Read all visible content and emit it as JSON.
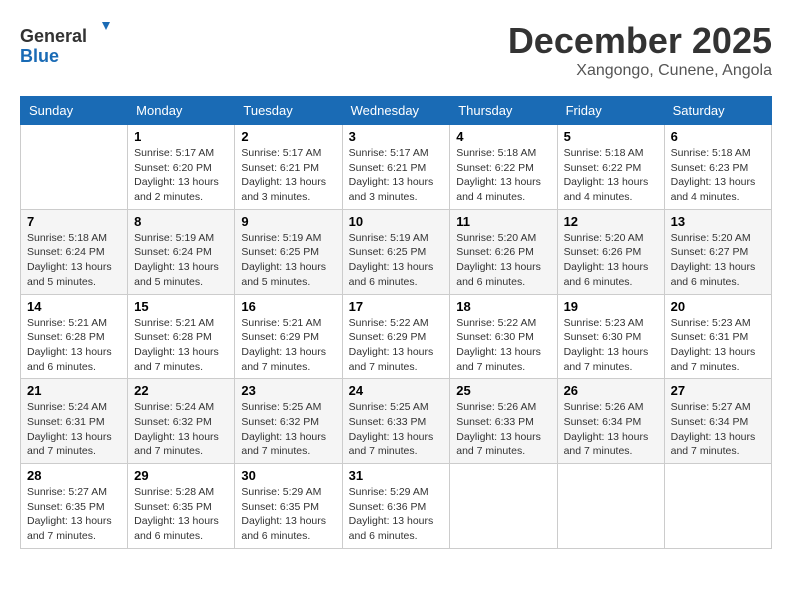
{
  "header": {
    "logo_line1": "General",
    "logo_line2": "Blue",
    "month": "December 2025",
    "location": "Xangongo, Cunene, Angola"
  },
  "weekdays": [
    "Sunday",
    "Monday",
    "Tuesday",
    "Wednesday",
    "Thursday",
    "Friday",
    "Saturday"
  ],
  "weeks": [
    [
      {
        "day": "",
        "info": ""
      },
      {
        "day": "1",
        "info": "Sunrise: 5:17 AM\nSunset: 6:20 PM\nDaylight: 13 hours\nand 2 minutes."
      },
      {
        "day": "2",
        "info": "Sunrise: 5:17 AM\nSunset: 6:21 PM\nDaylight: 13 hours\nand 3 minutes."
      },
      {
        "day": "3",
        "info": "Sunrise: 5:17 AM\nSunset: 6:21 PM\nDaylight: 13 hours\nand 3 minutes."
      },
      {
        "day": "4",
        "info": "Sunrise: 5:18 AM\nSunset: 6:22 PM\nDaylight: 13 hours\nand 4 minutes."
      },
      {
        "day": "5",
        "info": "Sunrise: 5:18 AM\nSunset: 6:22 PM\nDaylight: 13 hours\nand 4 minutes."
      },
      {
        "day": "6",
        "info": "Sunrise: 5:18 AM\nSunset: 6:23 PM\nDaylight: 13 hours\nand 4 minutes."
      }
    ],
    [
      {
        "day": "7",
        "info": "Sunrise: 5:18 AM\nSunset: 6:24 PM\nDaylight: 13 hours\nand 5 minutes."
      },
      {
        "day": "8",
        "info": "Sunrise: 5:19 AM\nSunset: 6:24 PM\nDaylight: 13 hours\nand 5 minutes."
      },
      {
        "day": "9",
        "info": "Sunrise: 5:19 AM\nSunset: 6:25 PM\nDaylight: 13 hours\nand 5 minutes."
      },
      {
        "day": "10",
        "info": "Sunrise: 5:19 AM\nSunset: 6:25 PM\nDaylight: 13 hours\nand 6 minutes."
      },
      {
        "day": "11",
        "info": "Sunrise: 5:20 AM\nSunset: 6:26 PM\nDaylight: 13 hours\nand 6 minutes."
      },
      {
        "day": "12",
        "info": "Sunrise: 5:20 AM\nSunset: 6:26 PM\nDaylight: 13 hours\nand 6 minutes."
      },
      {
        "day": "13",
        "info": "Sunrise: 5:20 AM\nSunset: 6:27 PM\nDaylight: 13 hours\nand 6 minutes."
      }
    ],
    [
      {
        "day": "14",
        "info": "Sunrise: 5:21 AM\nSunset: 6:28 PM\nDaylight: 13 hours\nand 6 minutes."
      },
      {
        "day": "15",
        "info": "Sunrise: 5:21 AM\nSunset: 6:28 PM\nDaylight: 13 hours\nand 7 minutes."
      },
      {
        "day": "16",
        "info": "Sunrise: 5:21 AM\nSunset: 6:29 PM\nDaylight: 13 hours\nand 7 minutes."
      },
      {
        "day": "17",
        "info": "Sunrise: 5:22 AM\nSunset: 6:29 PM\nDaylight: 13 hours\nand 7 minutes."
      },
      {
        "day": "18",
        "info": "Sunrise: 5:22 AM\nSunset: 6:30 PM\nDaylight: 13 hours\nand 7 minutes."
      },
      {
        "day": "19",
        "info": "Sunrise: 5:23 AM\nSunset: 6:30 PM\nDaylight: 13 hours\nand 7 minutes."
      },
      {
        "day": "20",
        "info": "Sunrise: 5:23 AM\nSunset: 6:31 PM\nDaylight: 13 hours\nand 7 minutes."
      }
    ],
    [
      {
        "day": "21",
        "info": "Sunrise: 5:24 AM\nSunset: 6:31 PM\nDaylight: 13 hours\nand 7 minutes."
      },
      {
        "day": "22",
        "info": "Sunrise: 5:24 AM\nSunset: 6:32 PM\nDaylight: 13 hours\nand 7 minutes."
      },
      {
        "day": "23",
        "info": "Sunrise: 5:25 AM\nSunset: 6:32 PM\nDaylight: 13 hours\nand 7 minutes."
      },
      {
        "day": "24",
        "info": "Sunrise: 5:25 AM\nSunset: 6:33 PM\nDaylight: 13 hours\nand 7 minutes."
      },
      {
        "day": "25",
        "info": "Sunrise: 5:26 AM\nSunset: 6:33 PM\nDaylight: 13 hours\nand 7 minutes."
      },
      {
        "day": "26",
        "info": "Sunrise: 5:26 AM\nSunset: 6:34 PM\nDaylight: 13 hours\nand 7 minutes."
      },
      {
        "day": "27",
        "info": "Sunrise: 5:27 AM\nSunset: 6:34 PM\nDaylight: 13 hours\nand 7 minutes."
      }
    ],
    [
      {
        "day": "28",
        "info": "Sunrise: 5:27 AM\nSunset: 6:35 PM\nDaylight: 13 hours\nand 7 minutes."
      },
      {
        "day": "29",
        "info": "Sunrise: 5:28 AM\nSunset: 6:35 PM\nDaylight: 13 hours\nand 6 minutes."
      },
      {
        "day": "30",
        "info": "Sunrise: 5:29 AM\nSunset: 6:35 PM\nDaylight: 13 hours\nand 6 minutes."
      },
      {
        "day": "31",
        "info": "Sunrise: 5:29 AM\nSunset: 6:36 PM\nDaylight: 13 hours\nand 6 minutes."
      },
      {
        "day": "",
        "info": ""
      },
      {
        "day": "",
        "info": ""
      },
      {
        "day": "",
        "info": ""
      }
    ]
  ]
}
